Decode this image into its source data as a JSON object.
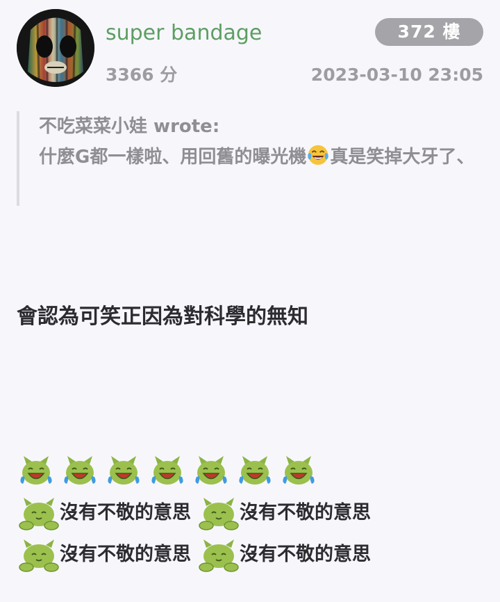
{
  "post": {
    "username": "super bandage",
    "floor": "372 樓",
    "score": "3366 分",
    "timestamp": "2023-03-10 23:05",
    "avatar_icon": "masked-figure-avatar",
    "quote": {
      "author": "不吃菜菜小娃 wrote:",
      "text_before_emoji": "什麼G都一樣啦、用回舊的曝光機",
      "emoji": "face-with-tears-of-joy-icon",
      "text_after_emoji": "真是笑掉大牙了、"
    },
    "body_text": "會認為可笑正因為對科學的無知",
    "sticker_rows": {
      "laughing_count": 7,
      "laughing_sticker": "green-blob-laughing-sticker",
      "calm_sticker": "green-blob-calm-sticker",
      "calm_labels": [
        "沒有不敬的意思",
        "沒有不敬的意思",
        "沒有不敬的意思",
        "沒有不敬的意思"
      ]
    },
    "colors": {
      "username": "#5c9e62",
      "badge_bg": "#a5a5a9",
      "meta_text": "#9d9da1",
      "quote_text": "#8e8e93",
      "body_text": "#2b2b30",
      "background": "#f7f7fb",
      "sticker_green": "#9bc04e"
    }
  }
}
